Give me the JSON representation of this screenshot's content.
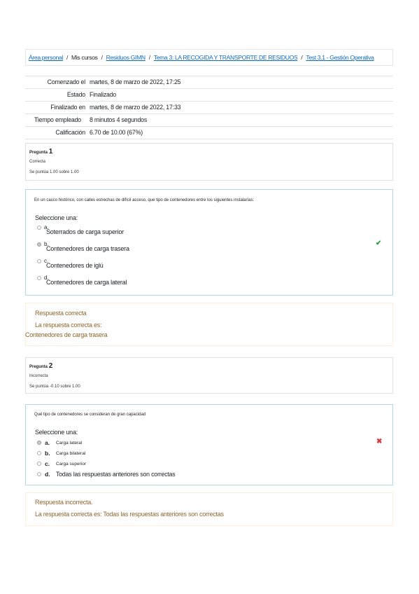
{
  "breadcrumb": {
    "items": [
      "Área personal",
      "Mis cursos",
      "Residuos GIMN",
      "Tema 3: LA RECOGIDA Y TRANSPORTE DE RESIDUOS",
      "Test 3.1 - Gestión Operativa"
    ],
    "separator": "/"
  },
  "summary": {
    "rows": [
      {
        "label": "Comenzado el",
        "value": "martes, 8 de marzo de 2022, 17:25"
      },
      {
        "label": "Estado",
        "value": "Finalizado"
      },
      {
        "label": "Finalizado en",
        "value": "martes, 8 de marzo de 2022, 17:33"
      },
      {
        "label": "Tiempo empleado",
        "value": "8 minutos 4 segundos"
      },
      {
        "label": "Calificación",
        "value": "6.70 de 10.00 (67%)"
      }
    ]
  },
  "q1": {
    "info_prefix": "Pregunta",
    "number": "1",
    "state": "Correcta",
    "mark": "Se puntúa 1.00 sobre 1.00",
    "text": "En un casco histórico, con calles estrechas de difícil acceso, que tipo de contenedores entre los siguientes instalarías:",
    "prompt": "Seleccione una:",
    "options": [
      {
        "letter": "a.",
        "text": "Soterrados de carga superior"
      },
      {
        "letter": "b.",
        "text": "Contenedores de carga trasera"
      },
      {
        "letter": "c.",
        "text": "Contenedores de iglú"
      },
      {
        "letter": "d.",
        "text": "Contenedores de carga lateral"
      }
    ],
    "selected_index": 1,
    "feedback_title": "Respuesta correcta",
    "feedback_line": "La respuesta correcta es:",
    "feedback_answer": "Contenedores de carga trasera",
    "mark_icon": "check-icon"
  },
  "q2": {
    "info_prefix": "Pregunta",
    "number": "2",
    "state": "Incorrecta",
    "mark": "Se puntúa -0.10 sobre 1.00",
    "text": "Qué tipo de contenedores se consideran de gran capacidad",
    "prompt": "Seleccione una:",
    "options": [
      {
        "letter": "a.",
        "text": "Carga lateral"
      },
      {
        "letter": "b.",
        "text": "Carga bilateral"
      },
      {
        "letter": "c.",
        "text": "Carga superior"
      },
      {
        "letter": "d.",
        "text": "Todas las respuestas anteriores son correctas"
      }
    ],
    "selected_index": 0,
    "feedback_title": "Respuesta incorrecta.",
    "feedback_line": "La respuesta correcta es: Todas las respuestas anteriores son correctas",
    "mark_icon": "cross-icon"
  },
  "colors": {
    "link": "#0f6cbf",
    "correct": "#2f9e44",
    "incorrect": "#d63c3c",
    "feedback": "#8e662e",
    "question_border": "#b5d6ea"
  }
}
